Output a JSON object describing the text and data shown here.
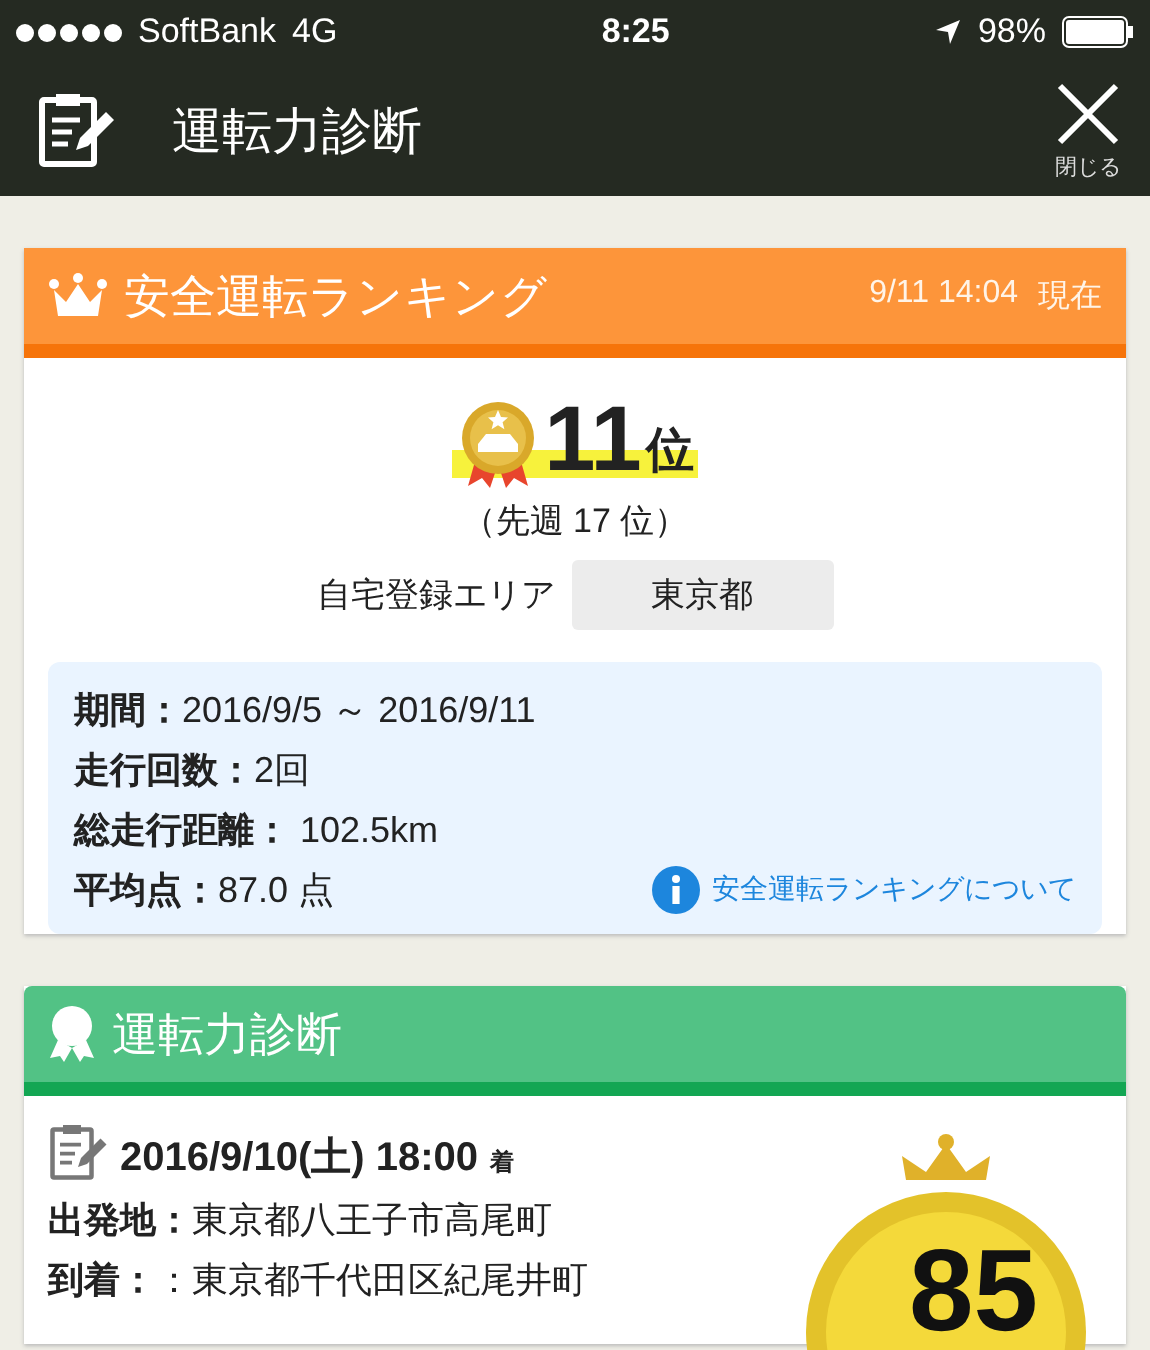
{
  "status_bar": {
    "carrier": "SoftBank",
    "network": "4G",
    "time": "8:25",
    "battery": "98%"
  },
  "header": {
    "title": "運転力診断",
    "close_label": "閉じる"
  },
  "ranking": {
    "title": "安全運転ランキング",
    "timestamp": "9/11 14:04",
    "timestamp_suffix": "現在",
    "rank": "11",
    "rank_unit": "位",
    "previous": "（先週 17 位）",
    "area_label": "自宅登録エリア",
    "area_value": "東京都",
    "stats": [
      "**期間：**2016/9/5 ～ 2016/9/11",
      "**走行回数：**2回",
      "**総走行距離：** 102.5km",
      "**平均点：**87.0 点"
    ],
    "info_link": "安全運転ランキングについて"
  },
  "diagnosis": {
    "title": "運転力診断",
    "trip_date": "2016/9/10(土) 18:00",
    "arrival_mark": "着",
    "rows": [
      "**出発地：**東京都八王子市高尾町",
      "**到着：**：東京都千代田区紀尾井町"
    ],
    "score": "85"
  }
}
